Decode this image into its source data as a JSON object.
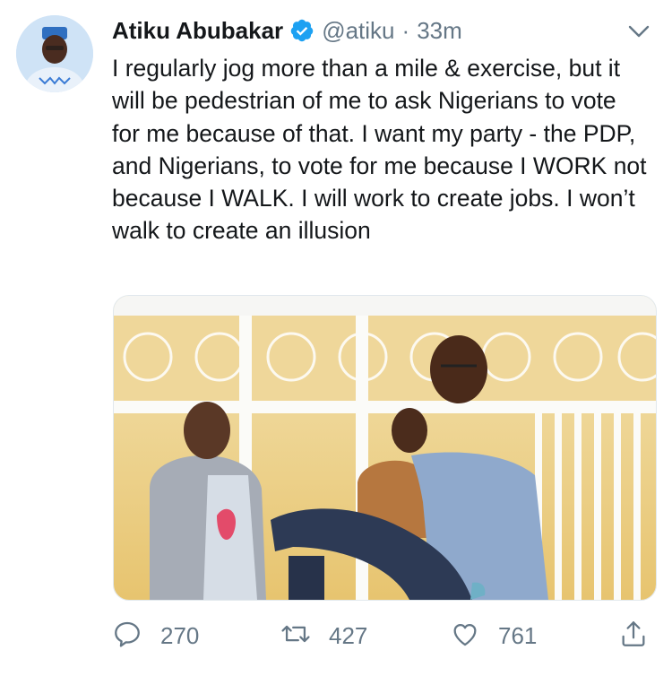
{
  "tweet": {
    "author_name": "Atiku Abubakar",
    "handle": "@atiku",
    "separator": "·",
    "timestamp": "33m",
    "text": "I regularly jog more than a mile & exercise, but it will be pedestrian of me to ask Nigerians to vote for me because of that. I want my party - the PDP, and Nigerians, to vote for me because I WORK not because I WALK. I will work to create jobs. I won’t walk to create an illusion",
    "replies": "270",
    "retweets": "427",
    "likes": "761"
  },
  "icons": {
    "verified": "verified-badge-icon",
    "menu": "chevron-down-icon",
    "reply": "reply-icon",
    "retweet": "retweet-icon",
    "like": "heart-icon",
    "share": "share-icon"
  },
  "colors": {
    "verified_blue": "#1da1f2",
    "secondary_text": "#657786",
    "primary_text": "#14171a"
  }
}
